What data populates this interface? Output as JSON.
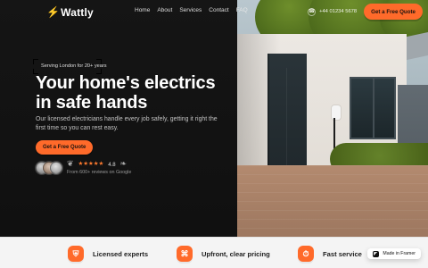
{
  "nav": {
    "logo_text": "Wattly",
    "links": [
      "Home",
      "About",
      "Services",
      "Contact",
      "FAQ"
    ],
    "phone": "+44 01234 5678",
    "cta_label": "Get a Free Quote"
  },
  "hero": {
    "badge": "Serving London for 20+ years",
    "headline": "Your home's electrics in safe hands",
    "subtext": "Our licensed electricians handle every job safely, getting it right the first time so you can rest easy.",
    "cta_label": "Get a Free Quote",
    "rating": {
      "stars": "★★★★★",
      "score": "4.8",
      "reviews_text": "From 600+ reviews on Google"
    }
  },
  "features": [
    {
      "title": "Licensed experts",
      "icon": "shield-icon"
    },
    {
      "title": "Upfront, clear pricing",
      "icon": "tag-icon"
    },
    {
      "title": "Fast service",
      "icon": "clock-icon"
    }
  ],
  "badges": {
    "framer": "Made in Framer"
  },
  "colors": {
    "accent": "#ff6a2a",
    "dark": "#111111",
    "light": "#f4f4f4"
  }
}
